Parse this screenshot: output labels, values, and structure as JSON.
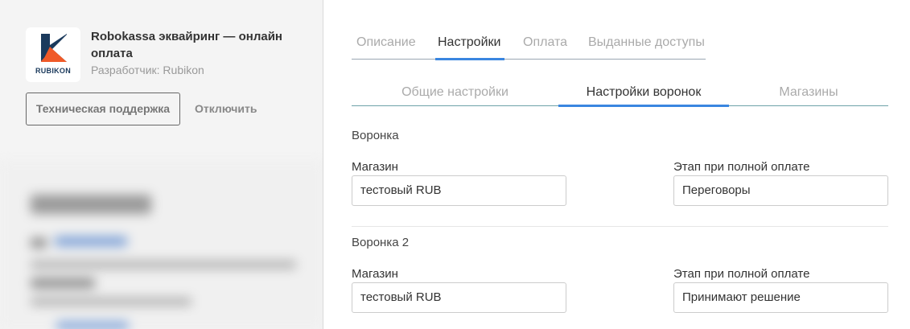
{
  "app": {
    "logo_text": "RUBIKON",
    "title": "Robokassa эквайринг — онлайн оплата",
    "developer": "Разработчик: Rubikon",
    "support_button": "Техническая поддержка",
    "disable_button": "Отключить"
  },
  "tabs": [
    {
      "label": "Описание",
      "active": false
    },
    {
      "label": "Настройки",
      "active": true
    },
    {
      "label": "Оплата",
      "active": false
    },
    {
      "label": "Выданные доступы",
      "active": false
    }
  ],
  "subtabs": [
    {
      "label": "Общие настройки",
      "active": false
    },
    {
      "label": "Настройки воронок",
      "active": true
    },
    {
      "label": "Магазины",
      "active": false
    }
  ],
  "funnels": [
    {
      "title": "Воронка",
      "store_label": "Магазин",
      "store_value": "тестовый RUB",
      "stage_label": "Этап при полной оплате",
      "stage_value": "Переговоры"
    },
    {
      "title": "Воронка 2",
      "store_label": "Магазин",
      "store_value": "тестовый RUB",
      "stage_label": "Этап при полной оплате",
      "stage_value": "Принимают решение"
    }
  ],
  "colors": {
    "accent": "#3a86e0",
    "logo_dark": "#1b3a5c",
    "logo_orange": "#f05a28"
  }
}
